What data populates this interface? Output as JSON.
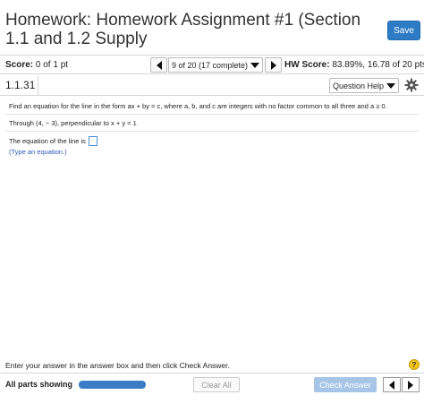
{
  "header": {
    "title": "Homework: Homework Assignment #1 (Section 1.1 and 1.2 Supply",
    "save_label": "Save"
  },
  "score_bar": {
    "score_label": "Score:",
    "score_value": "0 of 1 pt",
    "question_selector": "9 of 20 (17 complete)",
    "hw_score_label": "HW Score:",
    "hw_score_value": "83.89%, 16.78 of 20 pts"
  },
  "question_bar": {
    "number": "1.1.31",
    "help_label": "Question Help"
  },
  "question": {
    "prompt": "Find an equation for the line in the form ax + by = c, where a, b, and c are integers with no factor common to all three and a ≥ 0.",
    "through": "Through (4,  − 3), perpendicular to x + y = 1",
    "equation_label": "The equation of the line is",
    "hint": "(Type an equation.)"
  },
  "footer": {
    "instruction": "Enter your answer in the answer box and then click Check Answer.",
    "parts_label": "All parts showing",
    "progress": 1.0,
    "clear_label": "Clear All",
    "check_label": "Check Answer"
  },
  "colors": {
    "accent": "#2f7cc6",
    "check_disabled": "#a7c5e6",
    "progress_fill": "#3b7dc4",
    "help_yellow": "#f3c51b"
  },
  "icons": {
    "prev": "triangle-left-icon",
    "next": "triangle-right-icon",
    "settings": "gear-icon",
    "help": "question-circle-icon"
  }
}
